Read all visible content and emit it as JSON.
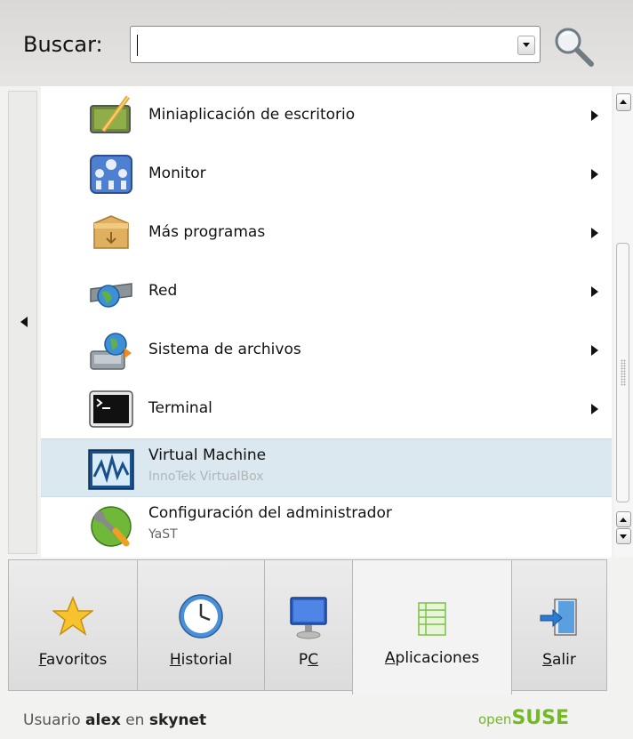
{
  "search": {
    "label": "Buscar:",
    "value": ""
  },
  "items": [
    {
      "label": "Miniaplicación de escritorio",
      "sub": "",
      "icon": "widget-icon",
      "submenu": true
    },
    {
      "label": "Monitor",
      "sub": "",
      "icon": "monitor-gauges-icon",
      "submenu": true
    },
    {
      "label": "Más programas",
      "sub": "",
      "icon": "box-icon",
      "submenu": true
    },
    {
      "label": "Red",
      "sub": "",
      "icon": "network-globe-icon",
      "submenu": true
    },
    {
      "label": "Sistema de archivos",
      "sub": "",
      "icon": "filesystem-icon",
      "submenu": true
    },
    {
      "label": "Terminal",
      "sub": "",
      "icon": "terminal-icon",
      "submenu": true
    },
    {
      "label": "Virtual Machine",
      "sub": "InnoTek VirtualBox",
      "icon": "virtualbox-icon",
      "submenu": false,
      "selected": true
    },
    {
      "label": "Configuración del administrador",
      "sub": "YaST",
      "icon": "yast-icon",
      "submenu": false
    }
  ],
  "tabs": [
    {
      "key": "F",
      "rest": "avoritos",
      "icon": "star-icon"
    },
    {
      "key": "H",
      "rest": "istorial",
      "icon": "clock-icon"
    },
    {
      "pre": "P",
      "key": "C",
      "icon": "computer-icon"
    },
    {
      "key": "A",
      "rest": "plicaciones",
      "icon": "applications-icon",
      "active": true
    },
    {
      "key": "S",
      "rest": "alir",
      "icon": "exit-icon"
    }
  ],
  "footer": {
    "prefix": "Usuario",
    "user": "alex",
    "mid": "en",
    "host": "skynet",
    "brand_small": "open",
    "brand_big": "SUSE"
  }
}
